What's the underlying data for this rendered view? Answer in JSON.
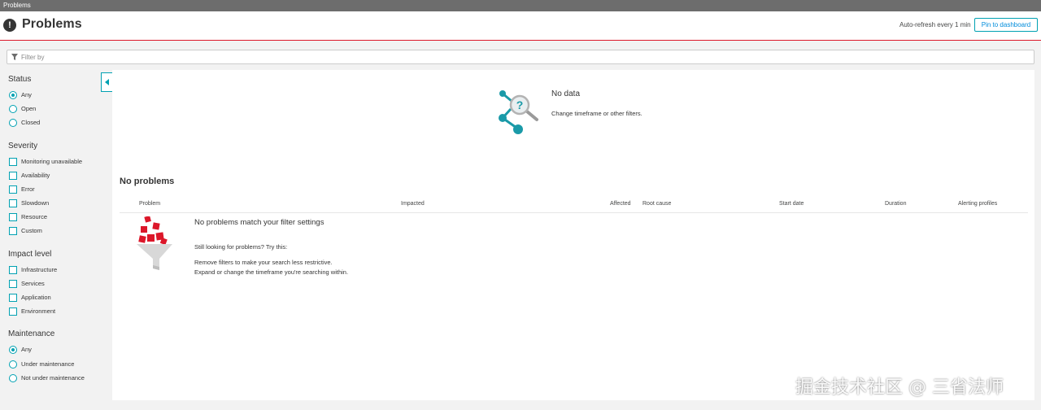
{
  "window": {
    "title": "Problems"
  },
  "header": {
    "title": "Problems",
    "auto_refresh": "Auto-refresh every 1 min",
    "pin_label": "Pin to dashboard"
  },
  "filter": {
    "placeholder": "Filter by"
  },
  "sidebar": {
    "status": {
      "title": "Status",
      "options": [
        "Any",
        "Open",
        "Closed"
      ],
      "selected": "Any"
    },
    "severity": {
      "title": "Severity",
      "options": [
        "Monitoring unavailable",
        "Availability",
        "Error",
        "Slowdown",
        "Resource",
        "Custom"
      ]
    },
    "impact": {
      "title": "Impact level",
      "options": [
        "Infrastructure",
        "Services",
        "Application",
        "Environment"
      ]
    },
    "maintenance": {
      "title": "Maintenance",
      "options": [
        "Any",
        "Under maintenance",
        "Not under maintenance"
      ],
      "selected": "Any"
    }
  },
  "nodata": {
    "title": "No data",
    "description": "Change timeframe or other filters."
  },
  "problems": {
    "heading": "No problems",
    "columns": [
      "Problem",
      "Impacted",
      "Affected",
      "Root cause",
      "Start date",
      "Duration",
      "Alerting profiles"
    ],
    "empty_title": "No problems match your filter settings",
    "empty_hint": "Still looking for problems? Try this:",
    "empty_tips": [
      "Remove filters to make your search less restrictive.",
      "Expand or change the timeframe you're searching within."
    ]
  },
  "watermark": "掘金技术社区 @ 三省法师",
  "colors": {
    "accent": "#00a1b2",
    "alert": "#dc172a",
    "text": "#353535"
  },
  "icons": [
    "alert-icon",
    "filter-icon",
    "collapse-arrow-icon",
    "no-data-icon",
    "funnel-icon"
  ]
}
